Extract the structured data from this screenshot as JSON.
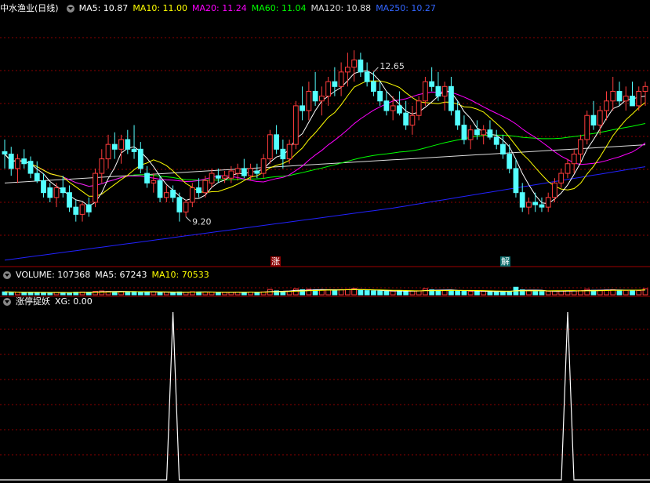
{
  "header": {
    "title": "中水渔业(日线)",
    "ma5": "MA5: 10.87",
    "ma10": "MA10: 11.00",
    "ma20": "MA20: 11.24",
    "ma60": "MA60: 11.04",
    "ma120": "MA120: 10.88",
    "ma250": "MA250: 10.27"
  },
  "volume_header": {
    "volume": "VOLUME: 107368",
    "ma5": "MA5: 67243",
    "ma10": "MA10: 70533"
  },
  "indicator_header": {
    "name": "涨停捉妖",
    "xg": "XG: 0.00"
  },
  "markers": {
    "zhang": "涨",
    "jie": "解"
  },
  "colors": {
    "up": "#ff3c3c",
    "down": "#54ffff",
    "grid": "#8b0000",
    "ma5": "#ffffff",
    "ma10": "#ffff00",
    "ma20": "#ff00ff",
    "ma60": "#00ff00",
    "ma120": "#dddddd",
    "ma250": "#2222ff"
  },
  "chart_data": [
    {
      "type": "candlestick",
      "title": "中水渔业(日线)",
      "annotations": [
        {
          "label": "12.65",
          "kind": "high",
          "x_index": 57
        },
        {
          "label": "9.20",
          "kind": "low",
          "x_index": 28
        }
      ],
      "ylim": [
        8.2,
        13.4
      ],
      "ohlc_note": "approximate daily open/high/low/close read from chart",
      "candles": [
        [
          10.55,
          10.8,
          10.2,
          10.5
        ],
        [
          10.5,
          10.65,
          10.05,
          10.2
        ],
        [
          10.2,
          10.5,
          9.9,
          10.4
        ],
        [
          10.4,
          10.6,
          10.2,
          10.3
        ],
        [
          10.35,
          10.45,
          10.0,
          10.1
        ],
        [
          10.1,
          10.35,
          9.9,
          9.95
        ],
        [
          9.95,
          10.1,
          9.6,
          9.7
        ],
        [
          9.8,
          9.9,
          9.5,
          9.6
        ],
        [
          9.6,
          9.9,
          9.4,
          9.8
        ],
        [
          9.8,
          10.05,
          9.6,
          9.7
        ],
        [
          9.7,
          9.85,
          9.3,
          9.4
        ],
        [
          9.4,
          9.55,
          9.1,
          9.25
        ],
        [
          9.25,
          9.5,
          9.1,
          9.45
        ],
        [
          9.45,
          9.6,
          9.2,
          9.3
        ],
        [
          9.5,
          10.2,
          9.4,
          10.1
        ],
        [
          10.1,
          10.6,
          9.9,
          10.4
        ],
        [
          10.4,
          10.9,
          10.2,
          10.7
        ],
        [
          10.7,
          10.95,
          10.4,
          10.6
        ],
        [
          10.6,
          10.9,
          10.3,
          10.8
        ],
        [
          10.8,
          11.0,
          10.5,
          10.6
        ],
        [
          10.6,
          11.1,
          10.4,
          10.55
        ],
        [
          10.6,
          10.75,
          10.1,
          10.2
        ],
        [
          10.1,
          10.25,
          9.8,
          9.9
        ],
        [
          9.9,
          10.1,
          9.7,
          9.95
        ],
        [
          9.95,
          10.05,
          9.5,
          9.6
        ],
        [
          9.6,
          9.85,
          9.5,
          9.7
        ],
        [
          9.75,
          9.85,
          9.5,
          9.6
        ],
        [
          9.6,
          9.7,
          9.1,
          9.3
        ],
        [
          9.3,
          9.55,
          9.2,
          9.5
        ],
        [
          9.5,
          9.9,
          9.4,
          9.8
        ],
        [
          9.8,
          10.0,
          9.6,
          9.7
        ],
        [
          9.7,
          10.05,
          9.6,
          9.95
        ],
        [
          9.9,
          10.2,
          9.8,
          10.1
        ],
        [
          10.05,
          10.2,
          9.9,
          10.0
        ],
        [
          10.0,
          10.15,
          9.9,
          10.05
        ],
        [
          10.0,
          10.25,
          9.9,
          10.15
        ],
        [
          10.1,
          10.3,
          9.95,
          10.2
        ],
        [
          10.2,
          10.4,
          10.0,
          10.05
        ],
        [
          10.05,
          10.3,
          9.95,
          10.2
        ],
        [
          10.15,
          10.3,
          10.0,
          10.1
        ],
        [
          10.1,
          10.5,
          10.0,
          10.4
        ],
        [
          10.4,
          11.0,
          10.3,
          10.9
        ],
        [
          10.9,
          11.1,
          10.5,
          10.6
        ],
        [
          10.6,
          10.8,
          10.2,
          10.4
        ],
        [
          10.4,
          10.8,
          10.3,
          10.7
        ],
        [
          10.7,
          11.6,
          10.6,
          11.5
        ],
        [
          11.5,
          11.9,
          11.2,
          11.4
        ],
        [
          11.4,
          12.0,
          11.2,
          11.8
        ],
        [
          11.8,
          12.2,
          11.5,
          11.6
        ],
        [
          11.6,
          11.9,
          11.3,
          11.7
        ],
        [
          11.7,
          12.1,
          11.5,
          12.0
        ],
        [
          12.0,
          12.3,
          11.7,
          11.9
        ],
        [
          11.9,
          12.4,
          11.7,
          12.2
        ],
        [
          12.2,
          12.6,
          11.9,
          12.3
        ],
        [
          12.3,
          12.65,
          12.0,
          12.45
        ],
        [
          12.45,
          12.6,
          12.1,
          12.2
        ],
        [
          12.2,
          12.4,
          11.9,
          12.0
        ],
        [
          12.0,
          12.2,
          11.7,
          11.8
        ],
        [
          11.8,
          12.0,
          11.5,
          11.6
        ],
        [
          11.6,
          11.8,
          11.3,
          11.4
        ],
        [
          11.4,
          11.7,
          11.2,
          11.5
        ],
        [
          11.5,
          11.8,
          11.3,
          11.35
        ],
        [
          11.35,
          11.6,
          11.0,
          11.1
        ],
        [
          11.1,
          11.5,
          10.9,
          11.3
        ],
        [
          11.3,
          11.7,
          11.2,
          11.6
        ],
        [
          11.6,
          12.1,
          11.5,
          12.0
        ],
        [
          12.0,
          12.3,
          11.8,
          11.9
        ],
        [
          11.9,
          12.2,
          11.6,
          11.7
        ],
        [
          11.7,
          12.0,
          11.4,
          11.9
        ],
        [
          11.9,
          12.1,
          11.3,
          11.4
        ],
        [
          11.4,
          11.6,
          11.0,
          11.1
        ],
        [
          11.1,
          11.3,
          10.7,
          10.8
        ],
        [
          10.8,
          11.1,
          10.6,
          11.0
        ],
        [
          11.0,
          11.2,
          10.8,
          10.9
        ],
        [
          10.9,
          11.1,
          10.7,
          11.0
        ],
        [
          11.0,
          11.2,
          10.8,
          10.85
        ],
        [
          10.85,
          11.0,
          10.6,
          10.7
        ],
        [
          10.7,
          10.9,
          10.4,
          10.5
        ],
        [
          10.5,
          10.7,
          10.1,
          10.2
        ],
        [
          10.2,
          10.4,
          9.6,
          9.7
        ],
        [
          9.7,
          9.9,
          9.3,
          9.4
        ],
        [
          9.4,
          9.6,
          9.25,
          9.5
        ],
        [
          9.5,
          9.7,
          9.3,
          9.45
        ],
        [
          9.45,
          9.6,
          9.3,
          9.4
        ],
        [
          9.4,
          9.7,
          9.3,
          9.6
        ],
        [
          9.6,
          10.0,
          9.5,
          9.9
        ],
        [
          9.9,
          10.2,
          9.8,
          10.1
        ],
        [
          10.1,
          10.4,
          10.0,
          10.3
        ],
        [
          10.3,
          10.6,
          10.1,
          10.5
        ],
        [
          10.5,
          10.9,
          10.3,
          10.8
        ],
        [
          10.8,
          11.4,
          10.7,
          11.3
        ],
        [
          11.3,
          11.6,
          11.0,
          11.1
        ],
        [
          11.1,
          11.5,
          10.9,
          11.4
        ],
        [
          11.4,
          11.8,
          11.2,
          11.6
        ],
        [
          11.6,
          12.1,
          11.4,
          11.8
        ],
        [
          11.8,
          12.0,
          11.5,
          11.6
        ],
        [
          11.6,
          11.9,
          11.4,
          11.7
        ],
        [
          11.7,
          12.0,
          11.5,
          11.5
        ],
        [
          11.5,
          11.9,
          11.4,
          11.8
        ],
        [
          11.8,
          12.0,
          11.5,
          11.9
        ]
      ]
    },
    {
      "type": "bar",
      "title": "VOLUME: 107368",
      "ylim": [
        0,
        250000
      ],
      "volumes": [
        52000,
        48000,
        45000,
        40000,
        43000,
        38000,
        41000,
        36000,
        44000,
        42000,
        39000,
        47000,
        50000,
        46000,
        62000,
        68000,
        60000,
        55000,
        58000,
        52000,
        57000,
        48000,
        45000,
        50000,
        43000,
        47000,
        41000,
        52000,
        49000,
        55000,
        51000,
        48000,
        46000,
        45000,
        44000,
        47000,
        49000,
        46000,
        50000,
        45000,
        52000,
        95000,
        70000,
        60000,
        65000,
        105000,
        90000,
        98000,
        88000,
        85000,
        92000,
        87000,
        93000,
        96000,
        110000,
        82000,
        75000,
        70000,
        68000,
        64000,
        66000,
        69000,
        63000,
        67000,
        72000,
        108000,
        88000,
        80000,
        79000,
        84000,
        72000,
        65000,
        60000,
        58000,
        62000,
        59000,
        57000,
        60000,
        64000,
        135000,
        88000,
        70000,
        61000,
        58000,
        63000,
        66000,
        69000,
        72000,
        71000,
        76000,
        98000,
        80000,
        82000,
        86000,
        90000,
        84000,
        78000,
        80000,
        76000,
        107368
      ]
    },
    {
      "type": "line",
      "title": "涨停捉妖",
      "ylim": [
        0,
        1
      ],
      "spikes_at_index": [
        26,
        87
      ],
      "value_label": "XG: 0.00"
    }
  ]
}
